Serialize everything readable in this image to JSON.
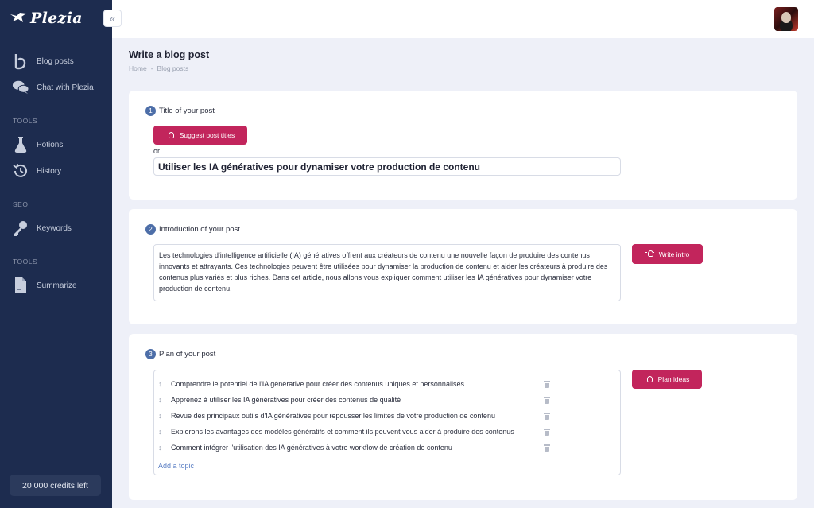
{
  "brand": {
    "name": "Plezia"
  },
  "sidebar": {
    "items": [
      {
        "label": "Blog posts",
        "icon": "blog-icon"
      },
      {
        "label": "Chat with Plezia",
        "icon": "chat-icon"
      }
    ],
    "sections": [
      {
        "label": "TOOLS",
        "items": [
          {
            "label": "Potions",
            "icon": "flask-icon"
          },
          {
            "label": "History",
            "icon": "history-icon"
          }
        ]
      },
      {
        "label": "SEO",
        "items": [
          {
            "label": "Keywords",
            "icon": "key-icon"
          }
        ]
      },
      {
        "label": "TOOLS",
        "items": [
          {
            "label": "Summarize",
            "icon": "document-icon"
          }
        ]
      }
    ],
    "credits": "20 000 credits left"
  },
  "page": {
    "title": "Write a blog post",
    "breadcrumb": [
      "Home",
      "-",
      "Blog posts"
    ]
  },
  "step1": {
    "num": "1",
    "label": "Title of your post",
    "button": "Suggest post titles",
    "or": "or",
    "title_value": "Utiliser les IA génératives pour dynamiser votre production de contenu"
  },
  "step2": {
    "num": "2",
    "label": "Introduction of your post",
    "button": "Write intro",
    "intro": "Les technologies d'intelligence artificielle (IA) génératives offrent aux créateurs de contenu une nouvelle façon de produire des contenus innovants et attrayants. Ces technologies peuvent être utilisées pour dynamiser la production de contenu et aider les créateurs à produire des contenus plus variés et plus riches. Dans cet article, nous allons vous expliquer comment utiliser les IA génératives pour dynamiser votre production de contenu."
  },
  "step3": {
    "num": "3",
    "label": "Plan of your post",
    "button": "Plan ideas",
    "topics": [
      "Comprendre le potentiel de l'IA générative pour créer des contenus uniques et personnalisés",
      "Apprenez à utiliser les IA génératives pour créer des contenus de qualité",
      "Revue des principaux outils d'IA génératives pour repousser les limites de votre production de contenu",
      "Explorons les avantages des modèles génératifs et comment ils peuvent vous aider à produire des contenus",
      "Comment intégrer l'utilisation des IA génératives à votre workflow de création de contenu"
    ],
    "add_topic": "Add a topic"
  },
  "colors": {
    "sidebar": "#1d2c4f",
    "accent": "#c2255c",
    "step_badge": "#4d6ea8",
    "link": "#5b7fc4"
  }
}
